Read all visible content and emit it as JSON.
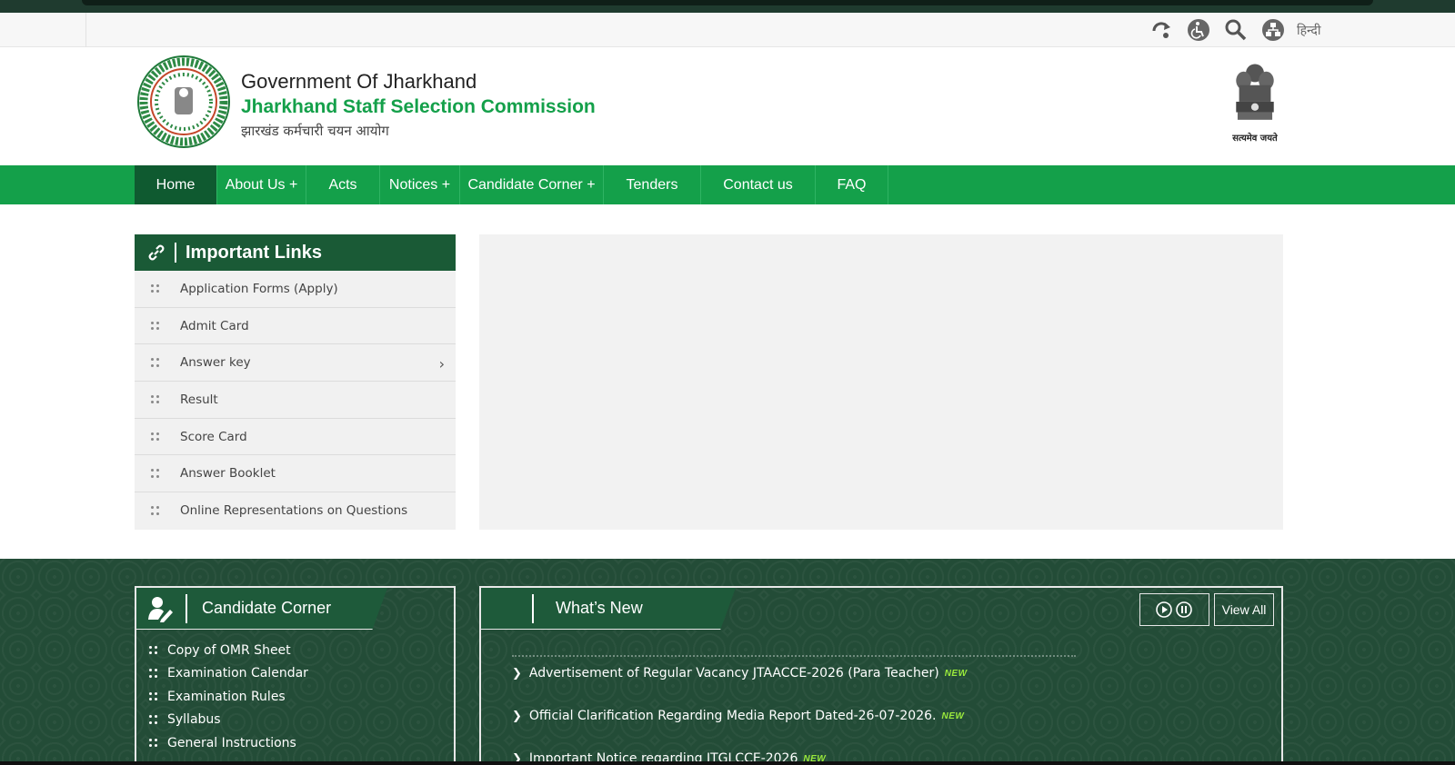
{
  "utility": {
    "icons": [
      "refresh-icon",
      "accessibility-icon",
      "search-icon",
      "sitemap-icon"
    ],
    "language_link": "हिन्दी"
  },
  "header": {
    "gov_title": "Government Of Jharkhand",
    "org_title": "Jharkhand Staff Selection Commission",
    "hindi_title": "झारखंड कर्मचारी चयन आयोग",
    "emblem_caption": "सत्यमेव जयते"
  },
  "nav": {
    "items": [
      {
        "label": "Home",
        "active": true
      },
      {
        "label": "About Us +"
      },
      {
        "label": "Acts"
      },
      {
        "label": "Notices +"
      },
      {
        "label": "Candidate Corner +"
      },
      {
        "label": "Tenders"
      },
      {
        "label": "Contact us"
      },
      {
        "label": "FAQ"
      }
    ]
  },
  "important_links": {
    "title": "Important Links",
    "items": [
      {
        "label": "Application Forms (Apply)"
      },
      {
        "label": "Admit Card"
      },
      {
        "label": "Answer key",
        "has_submenu": true
      },
      {
        "label": "Result"
      },
      {
        "label": "Score Card"
      },
      {
        "label": "Answer Booklet"
      },
      {
        "label": "Online Representations on Questions"
      }
    ],
    "submenu_arrow": "›"
  },
  "candidate_corner": {
    "title": "Candidate Corner",
    "items": [
      {
        "label": "Copy of OMR Sheet"
      },
      {
        "label": "Examination Calendar"
      },
      {
        "label": "Examination Rules"
      },
      {
        "label": "Syllabus"
      },
      {
        "label": "General Instructions"
      }
    ]
  },
  "whats_new": {
    "title": "What’s New",
    "view_all": "View All",
    "new_badge": "NEW",
    "items": [
      {
        "label": "Advertisement of Regular Vacancy JTAACCE-2026 (Para Teacher)",
        "is_new": true
      },
      {
        "label": "Official Clarification Regarding Media Report Dated-26-07-2026.",
        "is_new": true
      },
      {
        "label": "Important Notice regarding JTGLCCE-2026",
        "is_new": true
      }
    ]
  },
  "colors": {
    "brand_green": "#14a04a",
    "dark_green": "#1a5a36",
    "section_green": "#234c37",
    "new_badge": "#9bea3c"
  }
}
